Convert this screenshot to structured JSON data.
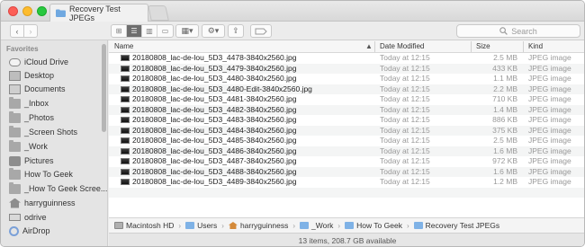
{
  "window": {
    "tab_title": "Recovery Test JPEGs"
  },
  "toolbar": {
    "back": "‹",
    "forward": "›",
    "view_icons": [
      "icon-view-icon",
      "list-view-icon",
      "column-view-icon",
      "cover-flow-icon"
    ],
    "group_label": "▦▾",
    "action_label": "⚙▾",
    "share_label": "⇪",
    "search_placeholder": "Search"
  },
  "sidebar": {
    "header": "Favorites",
    "items": [
      {
        "label": "iCloud Drive",
        "icon": "cloud-icon"
      },
      {
        "label": "Desktop",
        "icon": "desktop-icon"
      },
      {
        "label": "Documents",
        "icon": "documents-icon"
      },
      {
        "label": "_Inbox",
        "icon": "folder-icon"
      },
      {
        "label": "_Photos",
        "icon": "folder-icon"
      },
      {
        "label": "_Screen Shots",
        "icon": "folder-icon"
      },
      {
        "label": "_Work",
        "icon": "folder-icon"
      },
      {
        "label": "Pictures",
        "icon": "camera-icon"
      },
      {
        "label": "How To Geek",
        "icon": "folder-icon"
      },
      {
        "label": "_How To Geek Scree...",
        "icon": "folder-icon"
      },
      {
        "label": "harryguinness",
        "icon": "home-icon"
      },
      {
        "label": "odrive",
        "icon": "drive-icon"
      },
      {
        "label": "AirDrop",
        "icon": "airdrop-icon"
      }
    ]
  },
  "columns": {
    "name": "Name",
    "sort_indicator": "▲",
    "date": "Date Modified",
    "size": "Size",
    "kind": "Kind"
  },
  "files": [
    {
      "name": "20180808_lac-de-lou_5D3_4478-3840x2560.jpg",
      "date": "Today at 12:15",
      "size": "2.5 MB",
      "kind": "JPEG image"
    },
    {
      "name": "20180808_lac-de-lou_5D3_4479-3840x2560.jpg",
      "date": "Today at 12:15",
      "size": "433 KB",
      "kind": "JPEG image"
    },
    {
      "name": "20180808_lac-de-lou_5D3_4480-3840x2560.jpg",
      "date": "Today at 12:15",
      "size": "1.1 MB",
      "kind": "JPEG image"
    },
    {
      "name": "20180808_lac-de-lou_5D3_4480-Edit-3840x2560.jpg",
      "date": "Today at 12:15",
      "size": "2.2 MB",
      "kind": "JPEG image"
    },
    {
      "name": "20180808_lac-de-lou_5D3_4481-3840x2560.jpg",
      "date": "Today at 12:15",
      "size": "710 KB",
      "kind": "JPEG image"
    },
    {
      "name": "20180808_lac-de-lou_5D3_4482-3840x2560.jpg",
      "date": "Today at 12:15",
      "size": "1.4 MB",
      "kind": "JPEG image"
    },
    {
      "name": "20180808_lac-de-lou_5D3_4483-3840x2560.jpg",
      "date": "Today at 12:15",
      "size": "886 KB",
      "kind": "JPEG image"
    },
    {
      "name": "20180808_lac-de-lou_5D3_4484-3840x2560.jpg",
      "date": "Today at 12:15",
      "size": "375 KB",
      "kind": "JPEG image"
    },
    {
      "name": "20180808_lac-de-lou_5D3_4485-3840x2560.jpg",
      "date": "Today at 12:15",
      "size": "2.5 MB",
      "kind": "JPEG image"
    },
    {
      "name": "20180808_lac-de-lou_5D3_4486-3840x2560.jpg",
      "date": "Today at 12:15",
      "size": "1.6 MB",
      "kind": "JPEG image"
    },
    {
      "name": "20180808_lac-de-lou_5D3_4487-3840x2560.jpg",
      "date": "Today at 12:15",
      "size": "972 KB",
      "kind": "JPEG image"
    },
    {
      "name": "20180808_lac-de-lou_5D3_4488-3840x2560.jpg",
      "date": "Today at 12:15",
      "size": "1.6 MB",
      "kind": "JPEG image"
    },
    {
      "name": "20180808_lac-de-lou_5D3_4489-3840x2560.jpg",
      "date": "Today at 12:15",
      "size": "1.2 MB",
      "kind": "JPEG image"
    }
  ],
  "pathbar": [
    "Macintosh HD",
    "Users",
    "harryguinness",
    "_Work",
    "How To Geek",
    "Recovery Test JPEGs"
  ],
  "status": "13 items, 208.7 GB available"
}
